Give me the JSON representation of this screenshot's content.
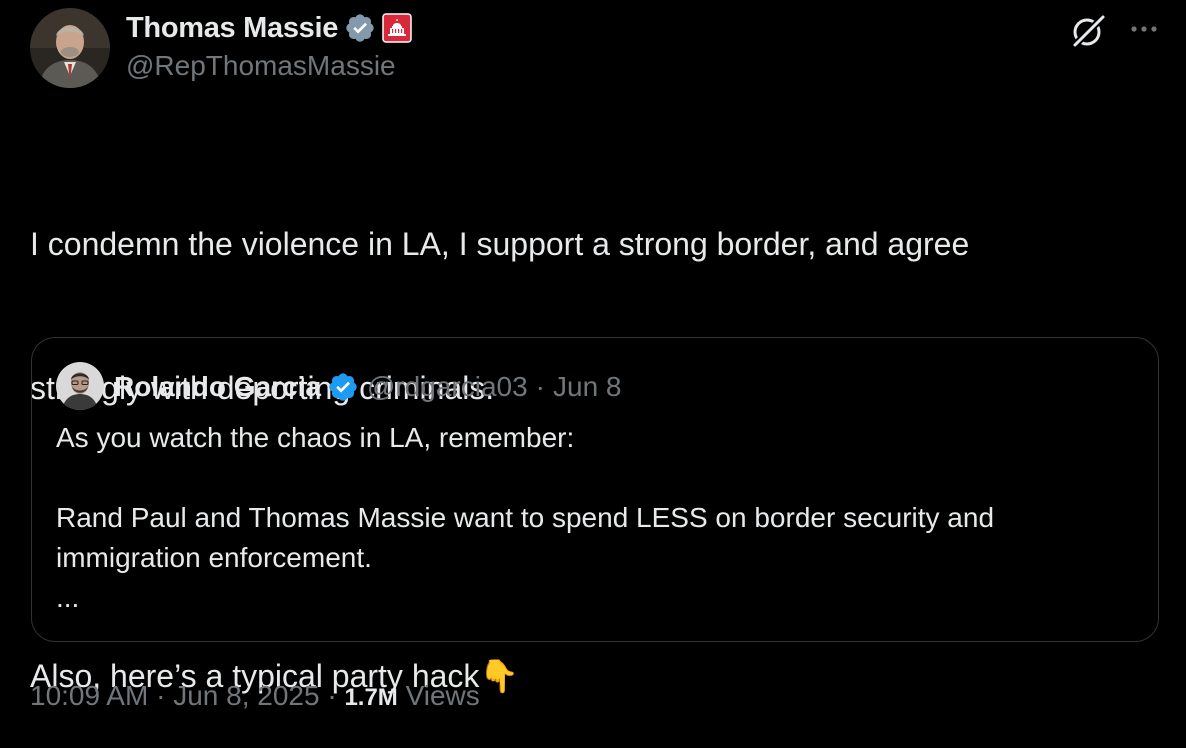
{
  "tweet": {
    "author_name": "Thomas Massie",
    "author_handle": "@RepThomasMassie",
    "text_line1": "I condemn the violence in LA, I support a strong border, and agree",
    "text_line2": "strongly with deporting criminals.",
    "text_line3": "Also, here’s a typical party hack👇",
    "time": "10:09 AM",
    "date": "Jun 8, 2025",
    "separator": "·",
    "views_count": "1.7M",
    "views_label": "Views"
  },
  "quote": {
    "author_name": "Rolando Garcia",
    "author_handle": "@rdgarcia03",
    "separator": "·",
    "date": "Jun 8",
    "text_line1": "As you watch the chaos in LA, remember:",
    "text_line2": "Rand Paul and Thomas Massie want to spend LESS on border security and",
    "text_line3": "immigration enforcement.",
    "text_line4": "..."
  },
  "icons": {
    "verified": "verified-badge-icon",
    "affiliation": "us-capitol-affiliation-icon",
    "grok": "grok-icon",
    "more": "more-options-icon"
  },
  "colors": {
    "background": "#000000",
    "text_primary": "#e7e9ea",
    "text_secondary": "#71767b",
    "verified_blue": "#1d9bf0",
    "verified_gray": "#829aab",
    "affiliation_red": "#e0245e",
    "border": "#2f3336"
  }
}
